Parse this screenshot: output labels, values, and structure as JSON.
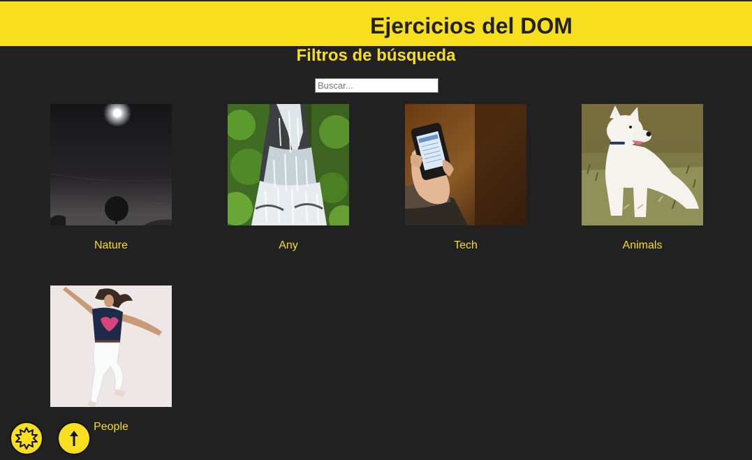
{
  "header": {
    "title": "Ejercicios del DOM"
  },
  "main": {
    "section_title": "Filtros de búsqueda",
    "search": {
      "placeholder": "Buscar...",
      "value": ""
    },
    "cards": [
      {
        "label": "Nature",
        "image": "night-moon-tree-photo"
      },
      {
        "label": "Any",
        "image": "waterfall-photo"
      },
      {
        "label": "Tech",
        "image": "hand-smartphone-photo"
      },
      {
        "label": "Animals",
        "image": "white-dog-photo"
      },
      {
        "label": "People",
        "image": "dancing-woman-photo"
      }
    ]
  },
  "floating_buttons": [
    {
      "icon": "theme-sun-icon"
    },
    {
      "icon": "arrow-up-icon"
    }
  ],
  "colors": {
    "accent": "#f7df1e",
    "background": "#212121",
    "header_text": "#222222"
  }
}
